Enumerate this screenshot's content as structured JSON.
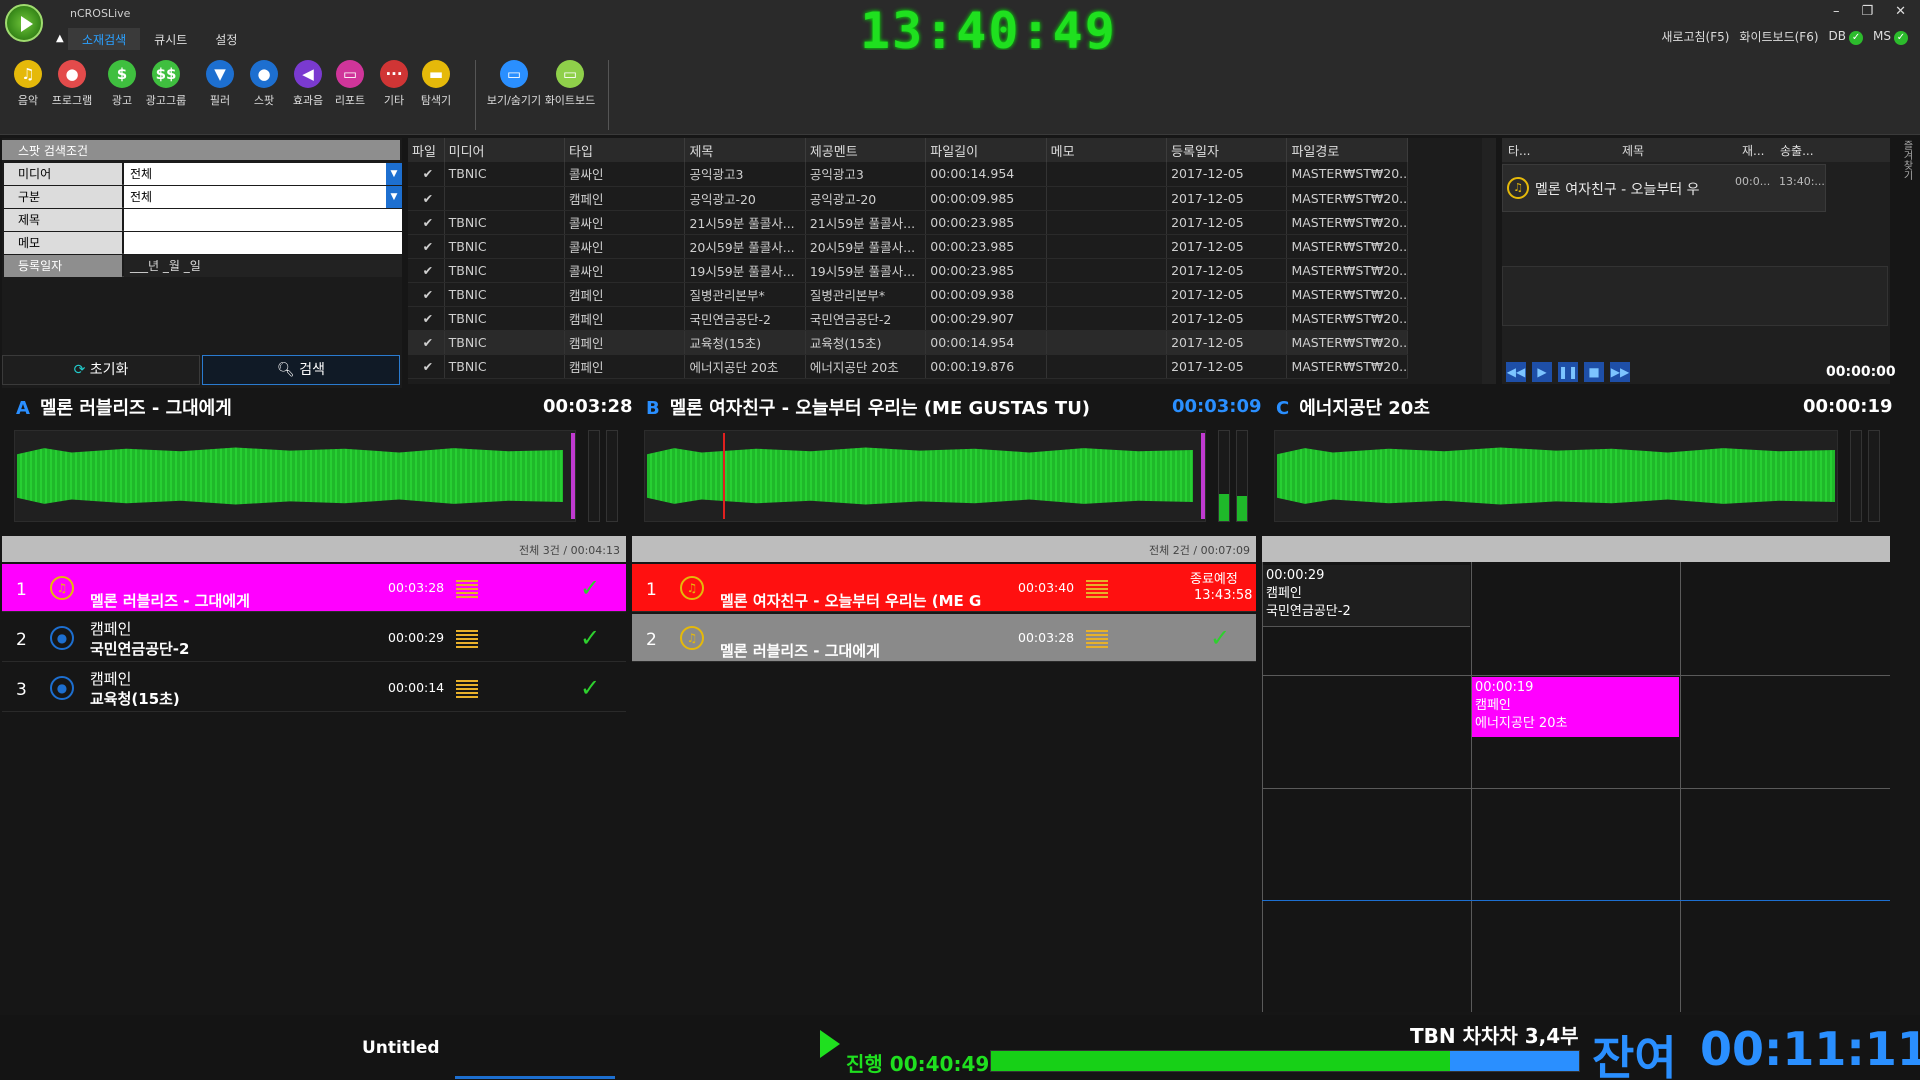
{
  "app": {
    "name": "nCROSLive",
    "clock": "13:40:49",
    "tabs": [
      "소재검색",
      "큐시트",
      "설정"
    ],
    "refresh": "새로고침(F5)",
    "whiteboard": "화이트보드(F6)",
    "db_label": "DB",
    "ms_label": "MS"
  },
  "toolbar": [
    {
      "label": "음악",
      "icon": "music-icon",
      "color": "#e5b90a",
      "glyph": "♫"
    },
    {
      "label": "프로그램",
      "icon": "microphone-icon",
      "color": "#e34b4b",
      "glyph": "●"
    },
    {
      "label": "광고",
      "icon": "dollar-icon",
      "color": "#3fbf3f",
      "glyph": "$"
    },
    {
      "label": "광고그룹",
      "icon": "dollar-group-icon",
      "color": "#3fbf3f",
      "glyph": "$$"
    },
    {
      "label": "필러",
      "icon": "filter-icon",
      "color": "#1d6fd0",
      "glyph": "▼"
    },
    {
      "label": "스팟",
      "icon": "pin-icon",
      "color": "#1d6fd0",
      "glyph": "●"
    },
    {
      "label": "효과음",
      "icon": "speaker-icon",
      "color": "#7a3ad0",
      "glyph": "◀"
    },
    {
      "label": "리포트",
      "icon": "folder-report-icon",
      "color": "#d0359a",
      "glyph": "▭"
    },
    {
      "label": "기타",
      "icon": "more-icon",
      "color": "#d03535",
      "glyph": "···"
    },
    {
      "label": "탐색기",
      "icon": "folder-icon",
      "color": "#e5b90a",
      "glyph": "▬"
    },
    {
      "label": "보기/숨기기",
      "icon": "window-icon",
      "color": "#2a8fff",
      "glyph": "▭"
    },
    {
      "label": "화이트보드",
      "icon": "whiteboard-icon",
      "color": "#8fd04a",
      "glyph": "▭"
    }
  ],
  "search": {
    "title": "스팟 검색조건",
    "fields": [
      {
        "label": "미디어",
        "value": "전체"
      },
      {
        "label": "구분",
        "value": "전체"
      },
      {
        "label": "제목",
        "value": ""
      },
      {
        "label": "메모",
        "value": ""
      },
      {
        "label": "등록일자",
        "value": "___년 _월 _일"
      }
    ],
    "reset": "초기화",
    "search": "검색"
  },
  "results": {
    "columns": [
      "파일",
      "미디어",
      "타입",
      "제목",
      "제공멘트",
      "파일길이",
      "메모",
      "등록일자",
      "파일경로"
    ],
    "rows": [
      [
        "✔",
        "TBNIC",
        "콜싸인",
        "공익광고3",
        "공익광고3",
        "00:00:14.954",
        "",
        "2017-12-05",
        "MASTER₩ST₩20..."
      ],
      [
        "✔",
        "",
        "캠페인",
        "공익광고-20",
        "공익광고-20",
        "00:00:09.985",
        "",
        "2017-12-05",
        "MASTER₩ST₩20..."
      ],
      [
        "✔",
        "TBNIC",
        "콜싸인",
        "21시59분 풀콜사...",
        "21시59분 풀콜사...",
        "00:00:23.985",
        "",
        "2017-12-05",
        "MASTER₩ST₩20..."
      ],
      [
        "✔",
        "TBNIC",
        "콜싸인",
        "20시59분 풀콜사...",
        "20시59분 풀콜사...",
        "00:00:23.985",
        "",
        "2017-12-05",
        "MASTER₩ST₩20..."
      ],
      [
        "✔",
        "TBNIC",
        "콜싸인",
        "19시59분 풀콜사...",
        "19시59분 풀콜사...",
        "00:00:23.985",
        "",
        "2017-12-05",
        "MASTER₩ST₩20..."
      ],
      [
        "✔",
        "TBNIC",
        "캠페인",
        "질병관리본부*",
        "질병관리본부*",
        "00:00:09.938",
        "",
        "2017-12-05",
        "MASTER₩ST₩20..."
      ],
      [
        "✔",
        "TBNIC",
        "캠페인",
        "국민연금공단-2",
        "국민연금공단-2",
        "00:00:29.907",
        "",
        "2017-12-05",
        "MASTER₩ST₩20..."
      ],
      [
        "✔",
        "TBNIC",
        "캠페인",
        "교육청(15초)",
        "교육청(15초)",
        "00:00:14.954",
        "",
        "2017-12-05",
        "MASTER₩ST₩20..."
      ],
      [
        "✔",
        "TBNIC",
        "캠페인",
        "에너지공단 20초",
        "에너지공단 20초",
        "00:00:19.876",
        "",
        "2017-12-05",
        "MASTER₩ST₩20..."
      ]
    ]
  },
  "side": {
    "columns": [
      "타...",
      "제목",
      "재...",
      "송출..."
    ],
    "item_title": "멜론 여자친구 - 오늘부터 우",
    "item_dur": "00:0...",
    "item_time": "13:40:...",
    "time": "00:00:00",
    "tab_label": "즐겨찾기"
  },
  "decks": [
    {
      "letter": "A",
      "title": "멜론 러블리즈 - 그대에게",
      "time": "00:03:28"
    },
    {
      "letter": "B",
      "title": "멜론 여자친구 - 오늘부터 우리는 (ME GUSTAS TU)",
      "time": "00:03:09"
    },
    {
      "letter": "C",
      "title": "에너지공단 20초",
      "time": "00:00:19"
    }
  ],
  "playlistA": {
    "summary": "전체 3건 / 00:04:13",
    "items": [
      {
        "num": "1",
        "l1": "",
        "l2": "멜론 러블리즈 - 그대에게",
        "dur": "00:03:28"
      },
      {
        "num": "2",
        "l1": "캠페인",
        "l2": "국민연금공단-2",
        "dur": "00:00:29"
      },
      {
        "num": "3",
        "l1": "캠페인",
        "l2": "교육청(15초)",
        "dur": "00:00:14"
      }
    ]
  },
  "playlistB": {
    "summary": "전체 2건 / 00:07:09",
    "items": [
      {
        "num": "1",
        "l2": "멜론 여자친구 - 오늘부터 우리는 (ME G",
        "dur": "00:03:40",
        "status": "종료예정",
        "end": "13:43:58"
      },
      {
        "num": "2",
        "l2": "멜론 러블리즈 - 그대에게",
        "dur": "00:03:28"
      }
    ]
  },
  "schedule": [
    {
      "time": "00:00:29",
      "type": "캠페인",
      "title": "국민연금공단-2"
    },
    {
      "time": "00:00:19",
      "type": "캠페인",
      "title": "에너지공단 20초"
    }
  ],
  "footer": {
    "doc": "Untitled",
    "progress_label": "진행",
    "progress_time": "00:40:49",
    "progress": 0.78,
    "program": "TBN 차차차 3,4부",
    "remain_label": "잔여",
    "remain_time": "00:11:11"
  }
}
